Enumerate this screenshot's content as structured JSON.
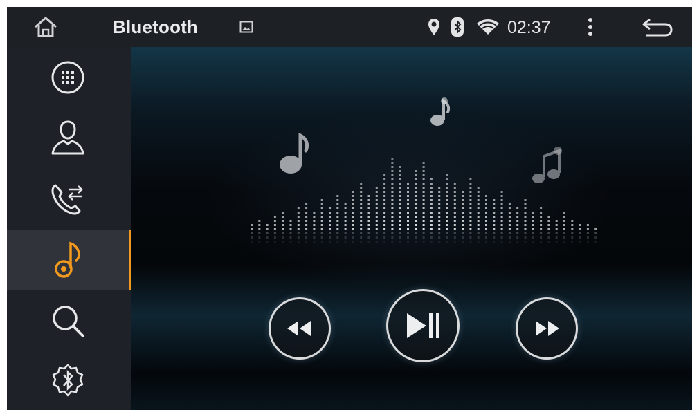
{
  "statusbar": {
    "title": "Bluetooth",
    "time": "02:37",
    "icons": [
      "home-icon",
      "gallery-icon",
      "location-icon",
      "bluetooth-icon",
      "wifi-icon",
      "menu-icon",
      "back-icon"
    ]
  },
  "sidebar": {
    "items": [
      {
        "name": "dialpad",
        "icon": "dialpad-icon",
        "active": false
      },
      {
        "name": "contacts",
        "icon": "contact-icon",
        "active": false
      },
      {
        "name": "call-log",
        "icon": "call-transfer-icon",
        "active": false
      },
      {
        "name": "music",
        "icon": "music-note-icon",
        "active": true
      },
      {
        "name": "search",
        "icon": "search-icon",
        "active": false
      },
      {
        "name": "settings",
        "icon": "bluetooth-settings-icon",
        "active": false
      }
    ]
  },
  "player": {
    "controls": [
      "previous-icon",
      "play-pause-icon",
      "next-icon"
    ]
  },
  "colors": {
    "accent": "#f29a1d",
    "statusbar_bg": "#1d2025",
    "sidebar_bg": "#1e2127",
    "icon": "#d8dadc"
  }
}
